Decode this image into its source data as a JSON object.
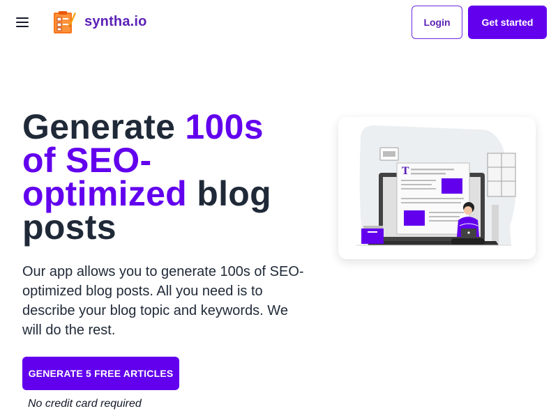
{
  "header": {
    "brand": "syntha.io",
    "login_label": "Login",
    "get_started_label": "Get started",
    "menu_icon": "hamburger-menu-icon",
    "logo_icon": "clipboard-logo-icon"
  },
  "hero": {
    "title_part1": "Generate ",
    "title_accent": "100s of SEO-optimized",
    "title_part2": " blog posts",
    "description": "Our app allows you to generate 100s of SEO-optimized blog posts. All you need is to describe your blog topic and keywords. We will do the rest.",
    "cta_label": "GENERATE 5 FREE ARTICLES",
    "note": "No credit card required"
  },
  "colors": {
    "accent": "#6200ee",
    "text": "#1f2937"
  }
}
